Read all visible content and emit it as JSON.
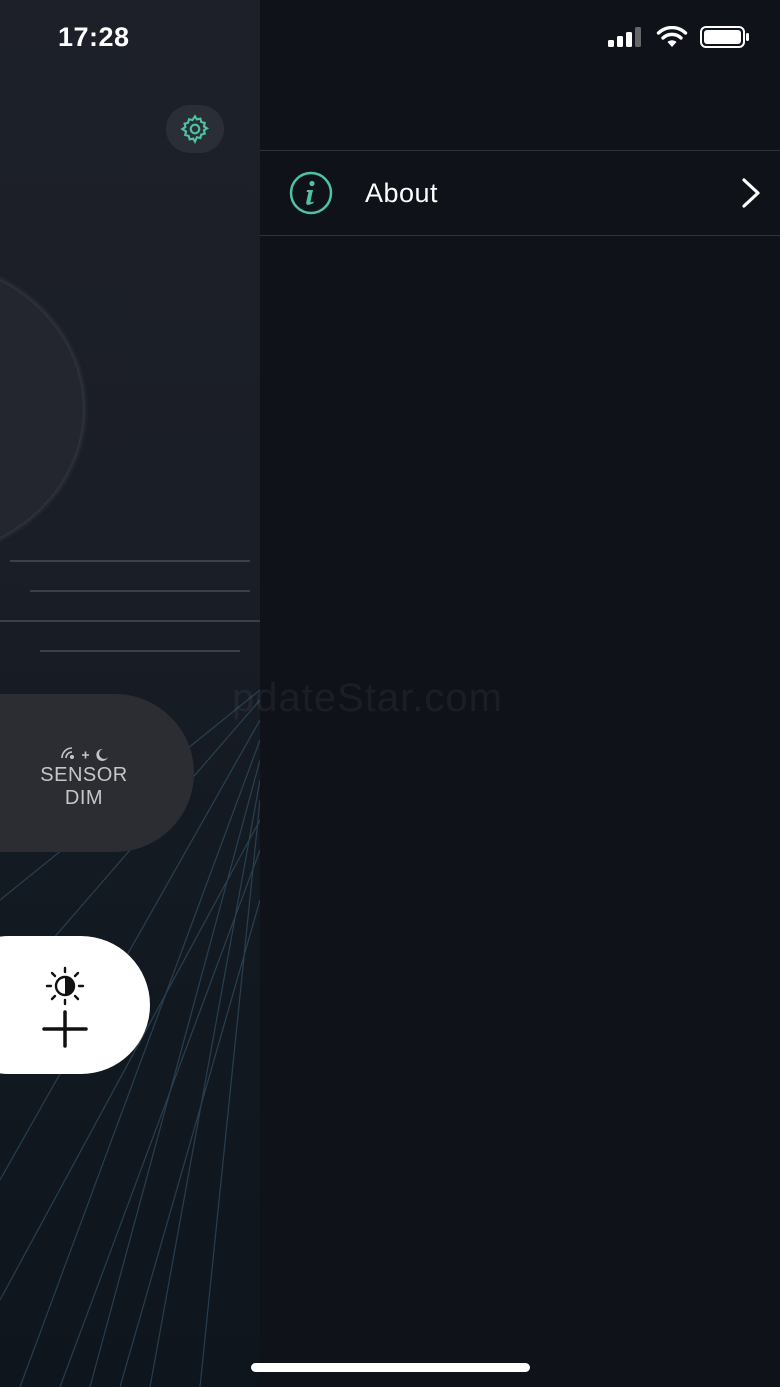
{
  "status_bar": {
    "time": "17:28"
  },
  "app": {
    "sensor_dim": {
      "line1": "SENSOR",
      "line2": "DIM"
    },
    "icons": {
      "settings": "gear-icon",
      "sensor": "sensor-moon-icon",
      "brightness": "brightness-contrast-icon",
      "add": "plus-icon"
    }
  },
  "drawer": {
    "items": [
      {
        "label": "About",
        "icon": "info-icon",
        "accessory": "chevron-right-icon"
      }
    ]
  },
  "watermark": "pdateStar.com",
  "colors": {
    "accent": "#4fc3a1",
    "drawer_bg": "#0f1219",
    "panel_bg": "#1d2028",
    "divider": "#2f333b"
  }
}
